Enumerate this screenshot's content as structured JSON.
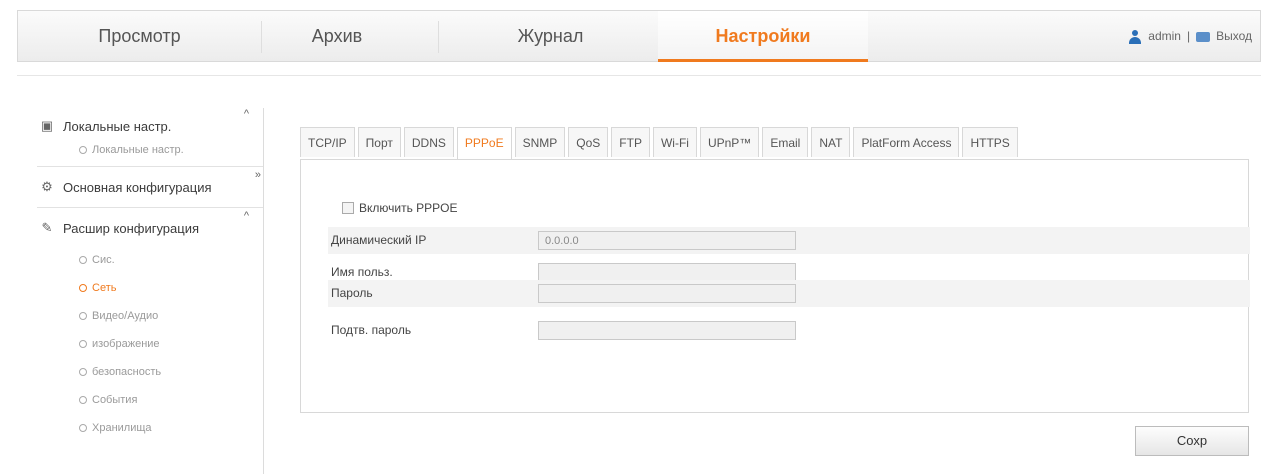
{
  "nav": {
    "tabs": [
      "Просмотр",
      "Архив",
      "Журнал",
      "Настройки"
    ],
    "active": "Настройки",
    "user": "admin",
    "separator": "|",
    "logout": "Выход"
  },
  "sidebar": {
    "local": {
      "label": "Локальные настр.",
      "chevron": "^",
      "items": [
        "Локальные настр."
      ]
    },
    "basic": {
      "label": "Основная конфигурация",
      "chevron": "»"
    },
    "advanced": {
      "label": "Расшир конфигурация",
      "chevron": "^",
      "items": [
        "Сис.",
        "Сеть",
        "Видео/Аудио",
        "изображение",
        "безопасность",
        "События",
        "Хранилища"
      ],
      "active": "Сеть"
    }
  },
  "tabs": [
    "TCP/IP",
    "Порт",
    "DDNS",
    "PPPoE",
    "SNMP",
    "QoS",
    "FTP",
    "Wi-Fi",
    "UPnP™",
    "Email",
    "NAT",
    "PlatForm Access",
    "HTTPS"
  ],
  "active_tab": "PPPoE",
  "form": {
    "enable_label": "Включить PPPOE",
    "enable_checked": false,
    "fields": [
      {
        "label": "Динамический IP",
        "value": "0.0.0.0"
      },
      {
        "label": "Имя польз.",
        "value": ""
      },
      {
        "label": "Пароль",
        "value": ""
      },
      {
        "label": "Подтв. пароль",
        "value": ""
      }
    ]
  },
  "save_label": "Сохр"
}
